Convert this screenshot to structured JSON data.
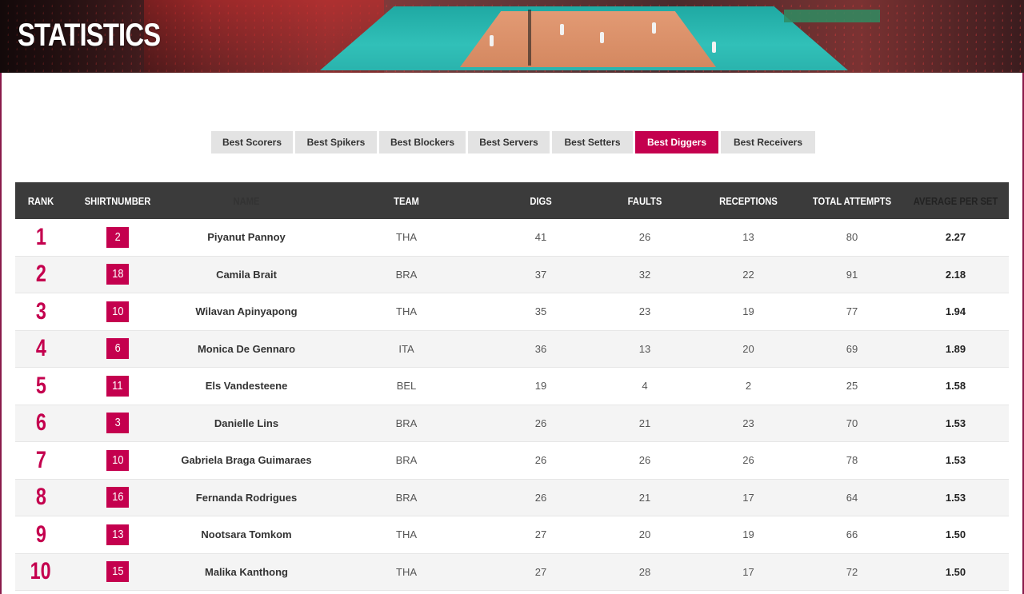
{
  "page": {
    "title": "STATISTICS"
  },
  "tabs": [
    {
      "label": "Best Scorers",
      "active": false
    },
    {
      "label": "Best Spikers",
      "active": false
    },
    {
      "label": "Best Blockers",
      "active": false
    },
    {
      "label": "Best Servers",
      "active": false
    },
    {
      "label": "Best Setters",
      "active": false
    },
    {
      "label": "Best Diggers",
      "active": true
    },
    {
      "label": "Best Receivers",
      "active": false
    }
  ],
  "table": {
    "headers": {
      "rank": "RANK",
      "shirt": "SHIRTNUMBER",
      "name": "NAME",
      "team": "TEAM",
      "digs": "DIGS",
      "faults": "FAULTS",
      "receptions": "RECEPTIONS",
      "total": "TOTAL ATTEMPTS",
      "avg": "AVERAGE PER SET"
    },
    "rows": [
      {
        "rank": "1",
        "shirt": "2",
        "name": "Piyanut Pannoy",
        "team": "THA",
        "digs": "41",
        "faults": "26",
        "receptions": "13",
        "total": "80",
        "avg": "2.27"
      },
      {
        "rank": "2",
        "shirt": "18",
        "name": "Camila Brait",
        "team": "BRA",
        "digs": "37",
        "faults": "32",
        "receptions": "22",
        "total": "91",
        "avg": "2.18"
      },
      {
        "rank": "3",
        "shirt": "10",
        "name": "Wilavan Apinyapong",
        "team": "THA",
        "digs": "35",
        "faults": "23",
        "receptions": "19",
        "total": "77",
        "avg": "1.94"
      },
      {
        "rank": "4",
        "shirt": "6",
        "name": "Monica De Gennaro",
        "team": "ITA",
        "digs": "36",
        "faults": "13",
        "receptions": "20",
        "total": "69",
        "avg": "1.89"
      },
      {
        "rank": "5",
        "shirt": "11",
        "name": "Els Vandesteene",
        "team": "BEL",
        "digs": "19",
        "faults": "4",
        "receptions": "2",
        "total": "25",
        "avg": "1.58"
      },
      {
        "rank": "6",
        "shirt": "3",
        "name": "Danielle Lins",
        "team": "BRA",
        "digs": "26",
        "faults": "21",
        "receptions": "23",
        "total": "70",
        "avg": "1.53"
      },
      {
        "rank": "7",
        "shirt": "10",
        "name": "Gabriela Braga Guimaraes",
        "team": "BRA",
        "digs": "26",
        "faults": "26",
        "receptions": "26",
        "total": "78",
        "avg": "1.53"
      },
      {
        "rank": "8",
        "shirt": "16",
        "name": "Fernanda Rodrigues",
        "team": "BRA",
        "digs": "26",
        "faults": "21",
        "receptions": "17",
        "total": "64",
        "avg": "1.53"
      },
      {
        "rank": "9",
        "shirt": "13",
        "name": "Nootsara Tomkom",
        "team": "THA",
        "digs": "27",
        "faults": "20",
        "receptions": "19",
        "total": "66",
        "avg": "1.50"
      },
      {
        "rank": "10",
        "shirt": "15",
        "name": "Malika Kanthong",
        "team": "THA",
        "digs": "27",
        "faults": "28",
        "receptions": "17",
        "total": "72",
        "avg": "1.50"
      }
    ]
  },
  "colors": {
    "accent": "#c4004e",
    "header_bg": "#3b3b3b",
    "tab_bg": "#e3e3e3",
    "frame": "#8a1a4a"
  }
}
